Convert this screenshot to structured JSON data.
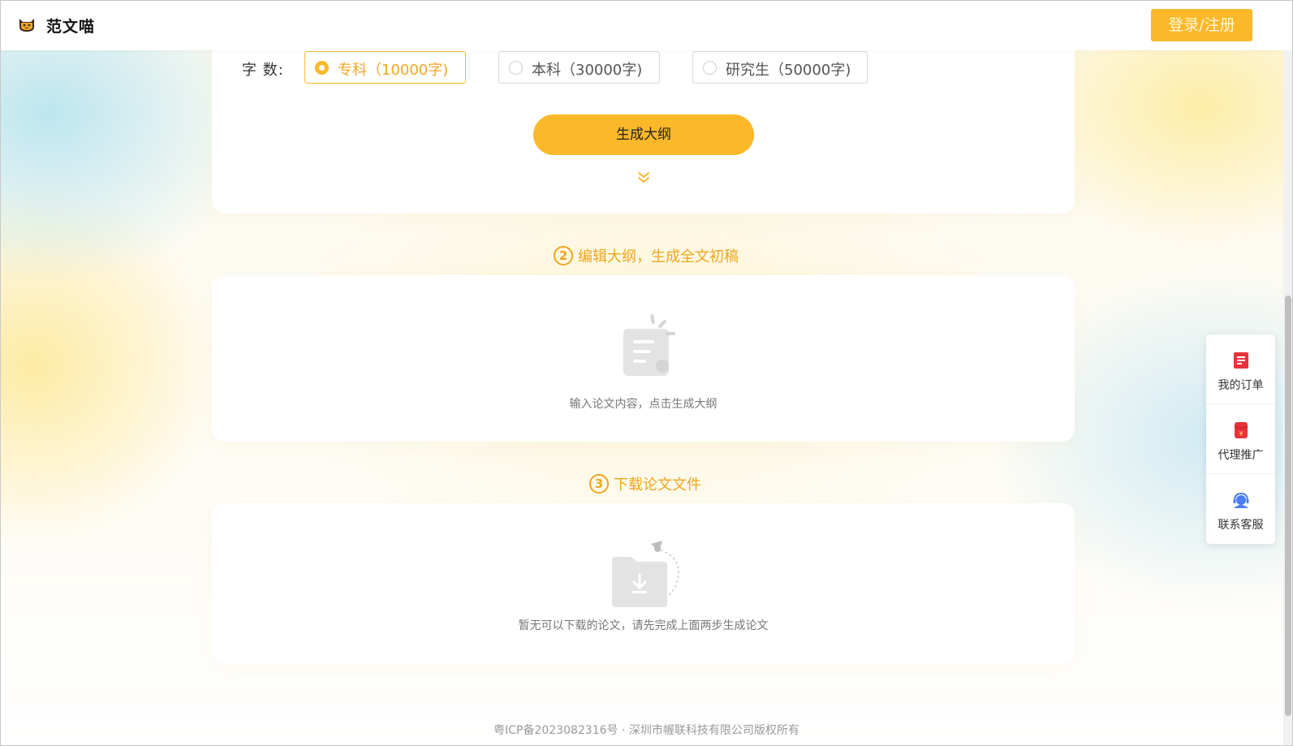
{
  "header": {
    "app_name": "范文喵",
    "login_label": "登录/注册"
  },
  "word_count": {
    "label": "字 数:",
    "options": [
      {
        "label": "专科（10000字)",
        "selected": true
      },
      {
        "label": "本科（30000字)",
        "selected": false
      },
      {
        "label": "研究生（50000字)",
        "selected": false
      }
    ]
  },
  "generate_outline_label": "生成大纲",
  "steps": [
    {
      "number": "2",
      "title": "编辑大纲，生成全文初稿",
      "empty_text": "输入论文内容，点击生成大纲"
    },
    {
      "number": "3",
      "title": "下载论文文件",
      "empty_text": "暂无可以下载的论文，请先完成上面两步生成论文"
    }
  ],
  "side_panel": {
    "items": [
      {
        "label": "我的订单",
        "icon": "order-icon"
      },
      {
        "label": "代理推广",
        "icon": "red-envelope-icon"
      },
      {
        "label": "联系客服",
        "icon": "customer-service-icon"
      }
    ]
  },
  "footer": {
    "text": "粤ICP备2023082316号 · 深圳市幄联科技有限公司版权所有"
  },
  "colors": {
    "accent": "#fbb829",
    "step_title": "#f0a51c",
    "side_icon_red": "#e8333b",
    "side_icon_blue": "#4c7ef3"
  }
}
